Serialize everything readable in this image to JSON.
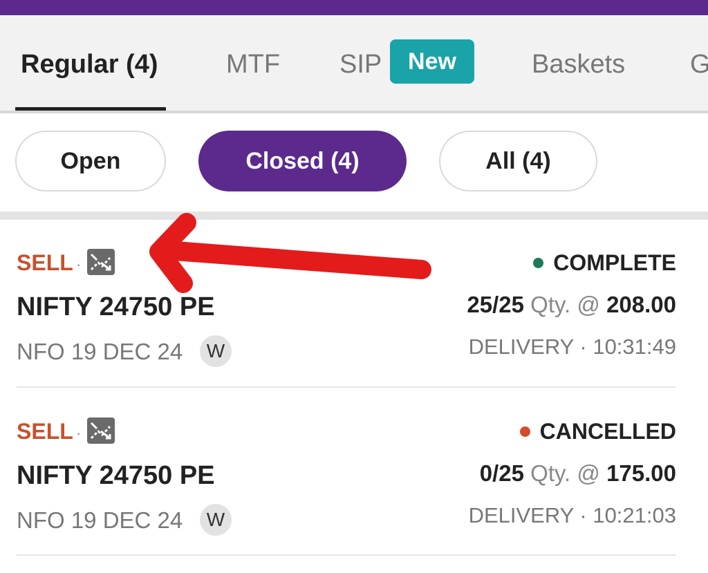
{
  "tabs": [
    {
      "label": "Regular (4)",
      "active": true
    },
    {
      "label": "MTF",
      "active": false
    },
    {
      "label": "SIP",
      "active": false,
      "badge": "New"
    },
    {
      "label": "Baskets",
      "active": false
    },
    {
      "label": "G",
      "active": false
    }
  ],
  "filters": [
    {
      "label": "Open",
      "selected": false
    },
    {
      "label": "Closed (4)",
      "selected": true
    },
    {
      "label": "All (4)",
      "selected": false
    }
  ],
  "orders": [
    {
      "side": "SELL",
      "sep": "·",
      "type_icon": "trade-type-icon",
      "symbol": "NIFTY 24750 PE",
      "exchange_expiry": "NFO 19 DEC 24",
      "expiry_badge": "W",
      "status": "COMPLETE",
      "status_color": "#1e7a5a",
      "filled": "25/25",
      "qty_label": "Qty. @",
      "price": "208.00",
      "product_time": "DELIVERY · 10:31:49"
    },
    {
      "side": "SELL",
      "sep": "·",
      "type_icon": "trade-type-icon",
      "symbol": "NIFTY 24750 PE",
      "exchange_expiry": "NFO 19 DEC 24",
      "expiry_badge": "W",
      "status": "CANCELLED",
      "status_color": "#d44c2a",
      "filled": "0/25",
      "qty_label": "Qty. @",
      "price": "175.00",
      "product_time": "DELIVERY · 10:21:03"
    }
  ],
  "colors": {
    "brand": "#5b2a8c",
    "badge": "#1aa3a8",
    "sell": "#c8502c",
    "annotation_arrow": "#e41b1b"
  }
}
